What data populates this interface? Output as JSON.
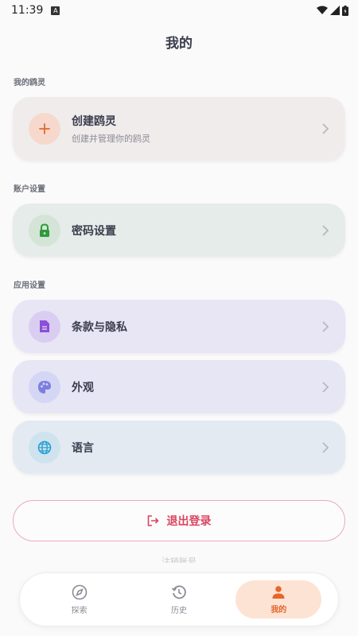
{
  "status_bar": {
    "time": "11:39",
    "badge": "A"
  },
  "header": {
    "title": "我的"
  },
  "sections": {
    "my_spirit": "我的鸥灵",
    "account": "账户设置",
    "app": "应用设置"
  },
  "cards": {
    "create_spirit": {
      "title": "创建鸥灵",
      "subtitle": "创建并管理你的鸥灵"
    },
    "password": {
      "title": "密码设置"
    },
    "terms": {
      "title": "条款与隐私"
    },
    "appearance": {
      "title": "外观"
    },
    "language": {
      "title": "语言"
    }
  },
  "actions": {
    "logout": "退出登录",
    "delete_account": "注销账号"
  },
  "nav": {
    "explore": "探索",
    "history": "历史",
    "mine": "我的",
    "active": "mine"
  },
  "colors": {
    "accent": "#e5672a",
    "logout": "#d9455f",
    "password_green": "#2e9a3e",
    "terms_purple": "#8b4fd8",
    "appearance_purple": "#7c7fe0",
    "language_blue": "#2a9fd0"
  }
}
